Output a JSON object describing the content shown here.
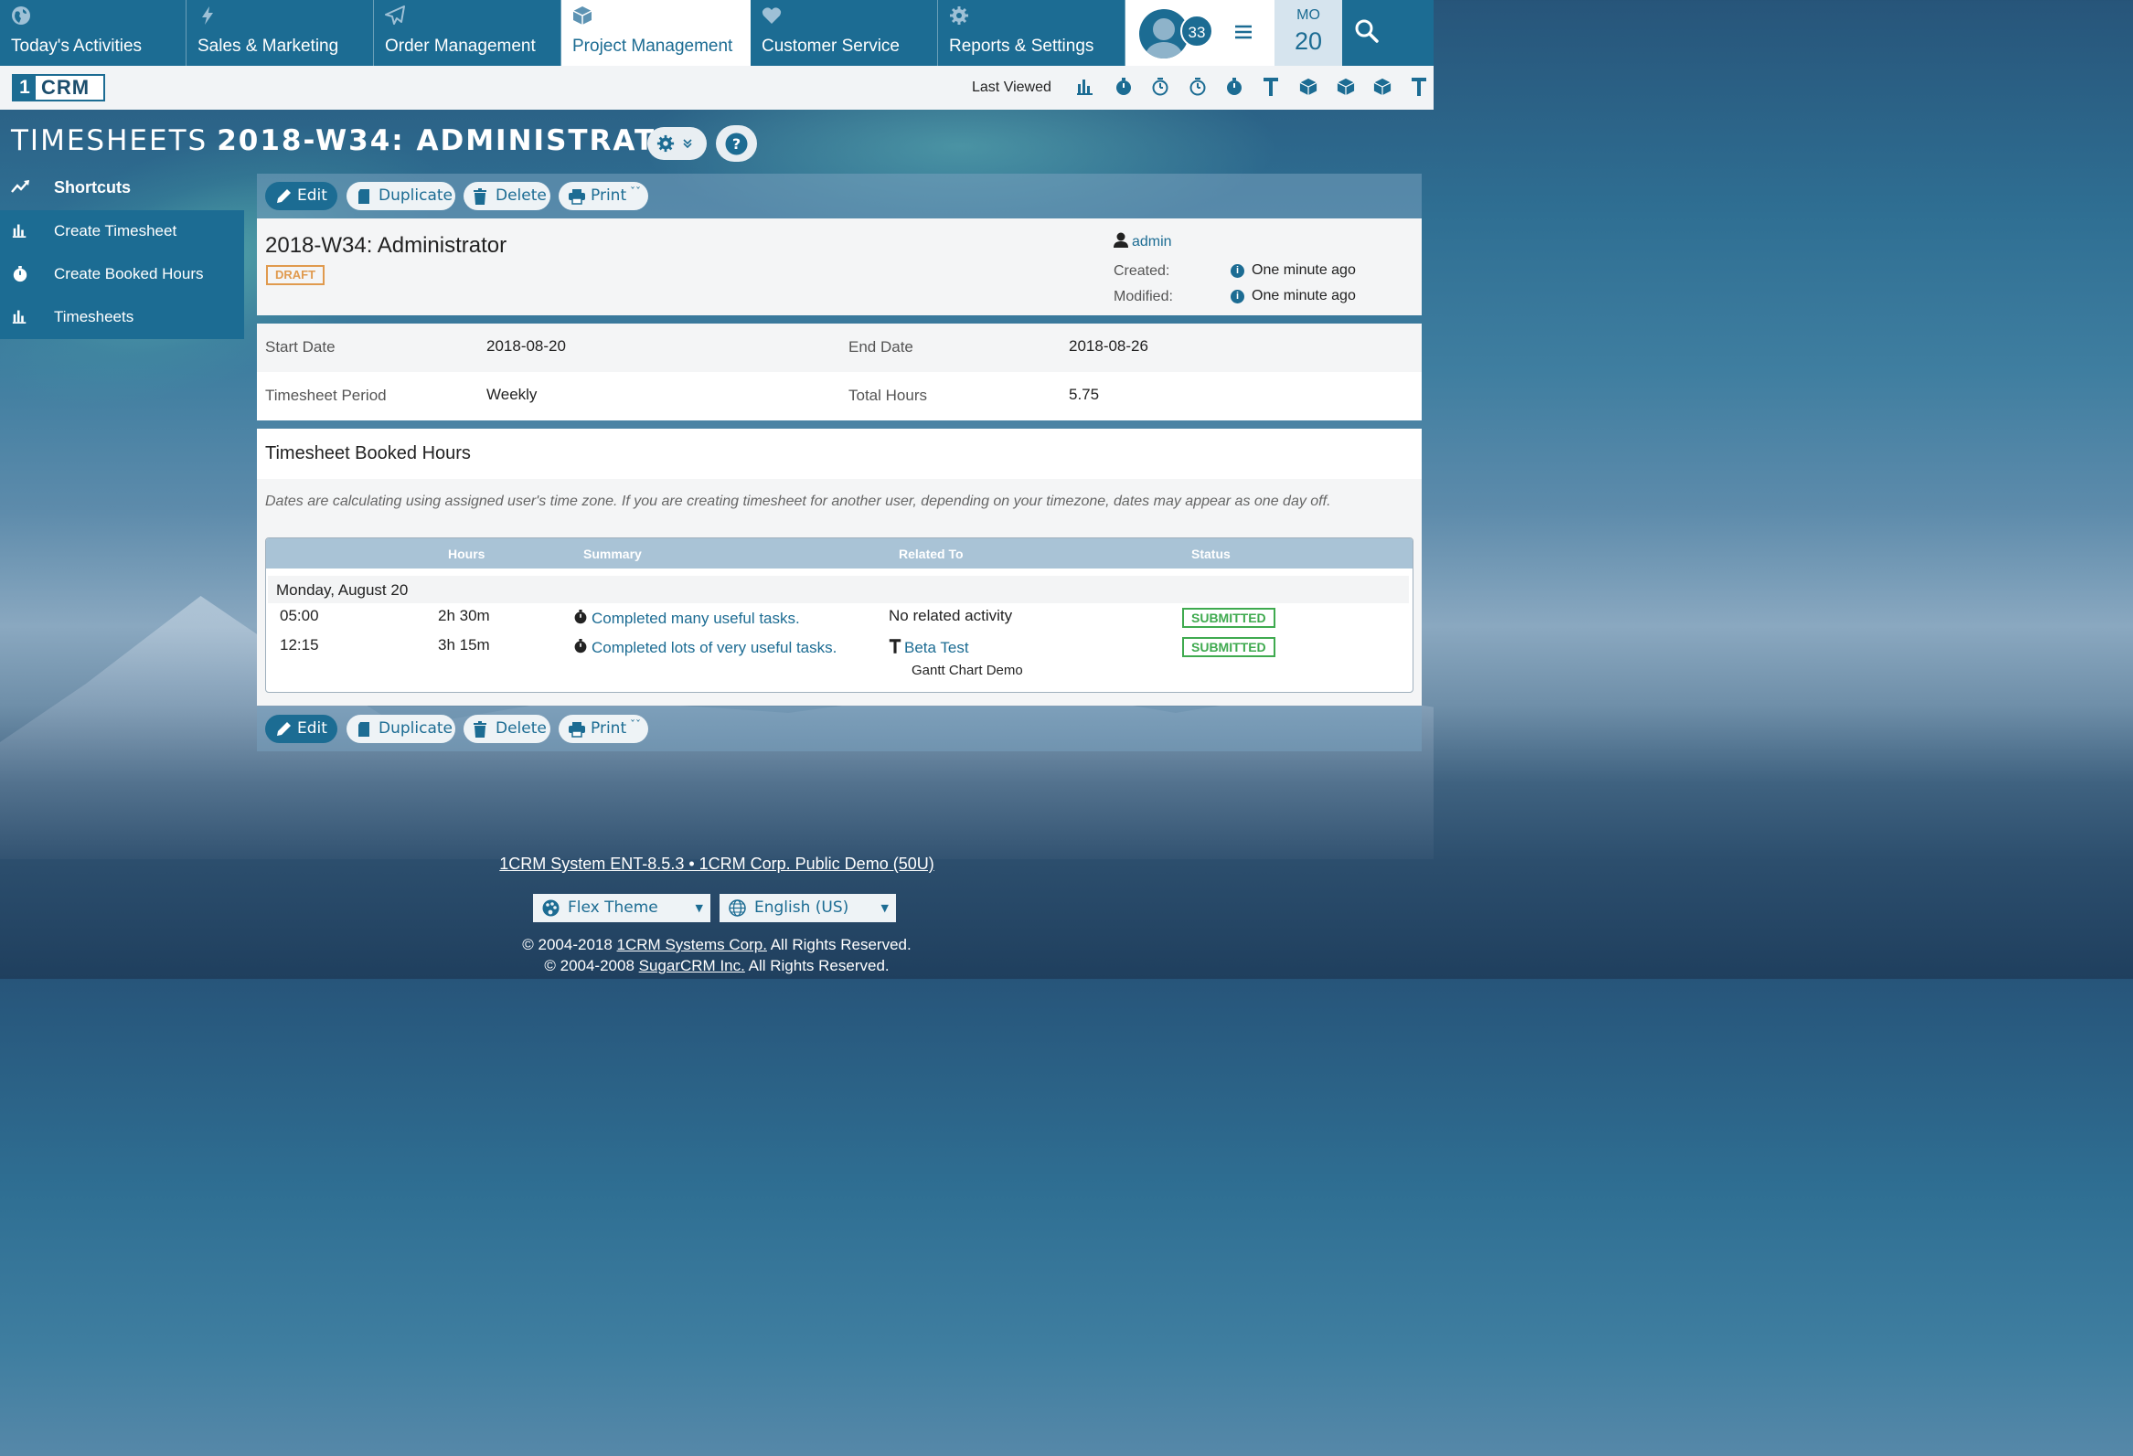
{
  "nav": {
    "tabs": [
      {
        "label": "Today's Activities",
        "icon": "globe-icon"
      },
      {
        "label": "Sales & Marketing",
        "icon": "bolt-icon"
      },
      {
        "label": "Order Management",
        "icon": "paper-plane-icon"
      },
      {
        "label": "Project Management",
        "icon": "cube-icon"
      },
      {
        "label": "Customer Service",
        "icon": "heart-icon"
      },
      {
        "label": "Reports & Settings",
        "icon": "gear-icon"
      }
    ],
    "active_tab": "Project Management",
    "notification_count": "33",
    "date_dow": "MO",
    "date_day": "20"
  },
  "subbar": {
    "logo_one": "1",
    "logo_crm": "CRM",
    "last_viewed_label": "Last Viewed",
    "last_viewed_icons": [
      "bar-chart-icon",
      "stopwatch-icon",
      "alarm-clock-icon",
      "alarm-clock-icon",
      "stopwatch-icon",
      "t-hammer-icon",
      "cube-icon",
      "cube-icon",
      "cube-icon",
      "t-hammer-icon"
    ]
  },
  "title": {
    "module": "TIMESHEETS",
    "record": "2018-W34: ADMINISTRATOR"
  },
  "sidebar": {
    "shortcuts_label": "Shortcuts",
    "items": [
      {
        "label": "Create Timesheet",
        "icon": "bar-chart-icon"
      },
      {
        "label": "Create Booked Hours",
        "icon": "stopwatch-icon"
      },
      {
        "label": "Timesheets",
        "icon": "bar-chart-icon"
      }
    ]
  },
  "actions": {
    "edit": "Edit",
    "duplicate": "Duplicate",
    "delete": "Delete",
    "print": "Print"
  },
  "record": {
    "name": "2018-W34: Administrator",
    "status_badge": "DRAFT",
    "owner": "admin",
    "created_label": "Created:",
    "created_value": "One minute ago",
    "modified_label": "Modified:",
    "modified_value": "One minute ago"
  },
  "fields": {
    "start_date_label": "Start Date",
    "start_date_value": "2018-08-20",
    "end_date_label": "End Date",
    "end_date_value": "2018-08-26",
    "period_label": "Timesheet Period",
    "period_value": "Weekly",
    "total_hours_label": "Total Hours",
    "total_hours_value": "5.75"
  },
  "booked_hours": {
    "title": "Timesheet Booked Hours",
    "note": "Dates are calculating using assigned user's time zone. If you are creating timesheet for another user, depending on your timezone, dates may appear as one day off.",
    "columns": [
      "Hours",
      "Summary",
      "Related To",
      "Status"
    ],
    "day_label": "Monday, August 20",
    "rows": [
      {
        "time": "05:00",
        "hours": "2h 30m",
        "summary": "Completed many useful tasks.",
        "related": "No related activity",
        "related_sub": "",
        "status": "SUBMITTED"
      },
      {
        "time": "12:15",
        "hours": "3h 15m",
        "summary": "Completed lots of very useful tasks.",
        "related": "Beta Test",
        "related_sub": "Gantt Chart Demo",
        "status": "SUBMITTED"
      }
    ]
  },
  "footer": {
    "system_link": "1CRM System ENT-8.5.3 • 1CRM Corp. Public Demo (50U)",
    "theme_select": "Flex Theme",
    "language_select": "English (US)",
    "copyright1_prefix": "© 2004-2018 ",
    "copyright1_link": "1CRM Systems Corp.",
    "copyright1_suffix": " All Rights Reserved.",
    "copyright2_prefix": "© 2004-2008 ",
    "copyright2_link": "SugarCRM Inc.",
    "copyright2_suffix": " All Rights Reserved."
  },
  "colors": {
    "brand": "#1c6c93",
    "draft": "#e09a4e",
    "submitted": "#3faa4f"
  }
}
